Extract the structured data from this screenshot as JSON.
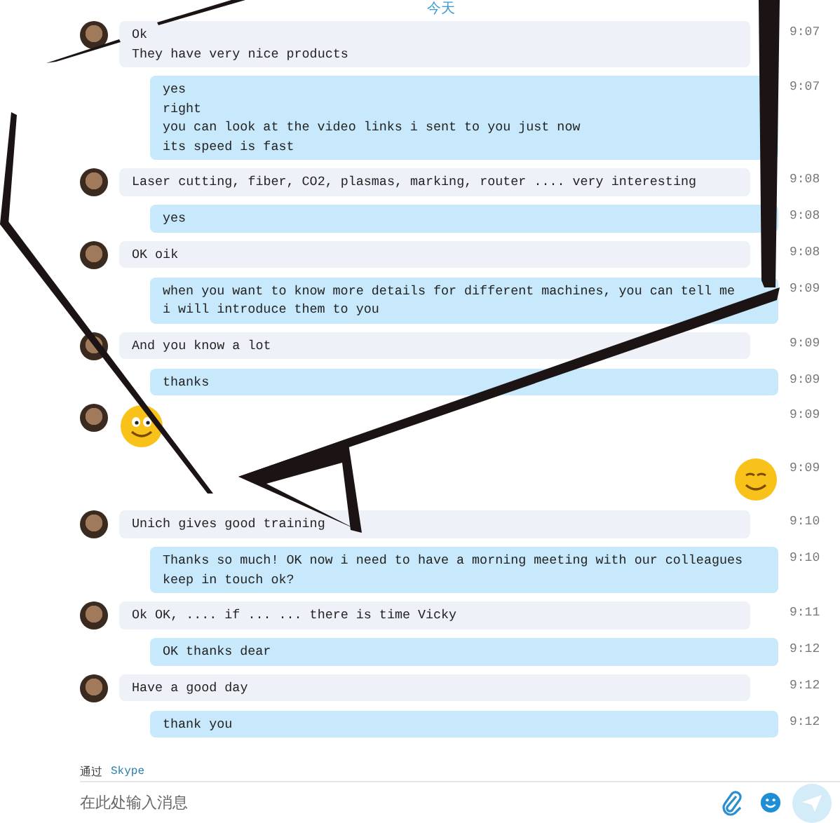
{
  "date_divider": "今天",
  "messages": [
    {
      "kind": "incoming",
      "lines": [
        "Ok",
        "They have very nice products"
      ],
      "time": "9:07"
    },
    {
      "kind": "outgoing",
      "lines": [
        "yes",
        "right",
        "you can look at the video links i sent to you just now",
        "its speed is fast"
      ],
      "time": "9:07"
    },
    {
      "kind": "incoming",
      "lines": [
        "Laser cutting, fiber, CO2, plasmas, marking, router .... very interesting"
      ],
      "time": "9:08"
    },
    {
      "kind": "outgoing",
      "lines": [
        "yes"
      ],
      "time": "9:08"
    },
    {
      "kind": "incoming",
      "lines": [
        "OK oik"
      ],
      "time": "9:08"
    },
    {
      "kind": "outgoing",
      "lines": [
        "when you want to know more details for different machines, you can tell me",
        "i will introduce them to you"
      ],
      "time": "9:09"
    },
    {
      "kind": "incoming",
      "lines": [
        "And you know a lot"
      ],
      "time": "9:09"
    },
    {
      "kind": "outgoing",
      "lines": [
        "thanks"
      ],
      "time": "9:09"
    },
    {
      "kind": "incoming_emoji",
      "time": "9:09"
    },
    {
      "kind": "outgoing_emoji",
      "time": "9:09"
    },
    {
      "kind": "incoming",
      "lines": [
        "Unich gives good training"
      ],
      "time": "9:10"
    },
    {
      "kind": "outgoing",
      "lines": [
        "Thanks so much! OK now i need to have a morning meeting with our colleagues",
        "keep in touch ok?"
      ],
      "time": "9:10"
    },
    {
      "kind": "incoming",
      "lines": [
        "Ok OK, .... if ... ... there is time Vicky"
      ],
      "time": "9:11"
    },
    {
      "kind": "outgoing",
      "lines": [
        "OK thanks dear"
      ],
      "time": "9:12"
    },
    {
      "kind": "incoming",
      "lines": [
        "Have a good day"
      ],
      "time": "9:12"
    },
    {
      "kind": "outgoing",
      "lines": [
        "thank you"
      ],
      "time": "9:12"
    }
  ],
  "via": {
    "label": "通过",
    "service": "Skype"
  },
  "composer": {
    "placeholder": "在此处输入消息"
  }
}
